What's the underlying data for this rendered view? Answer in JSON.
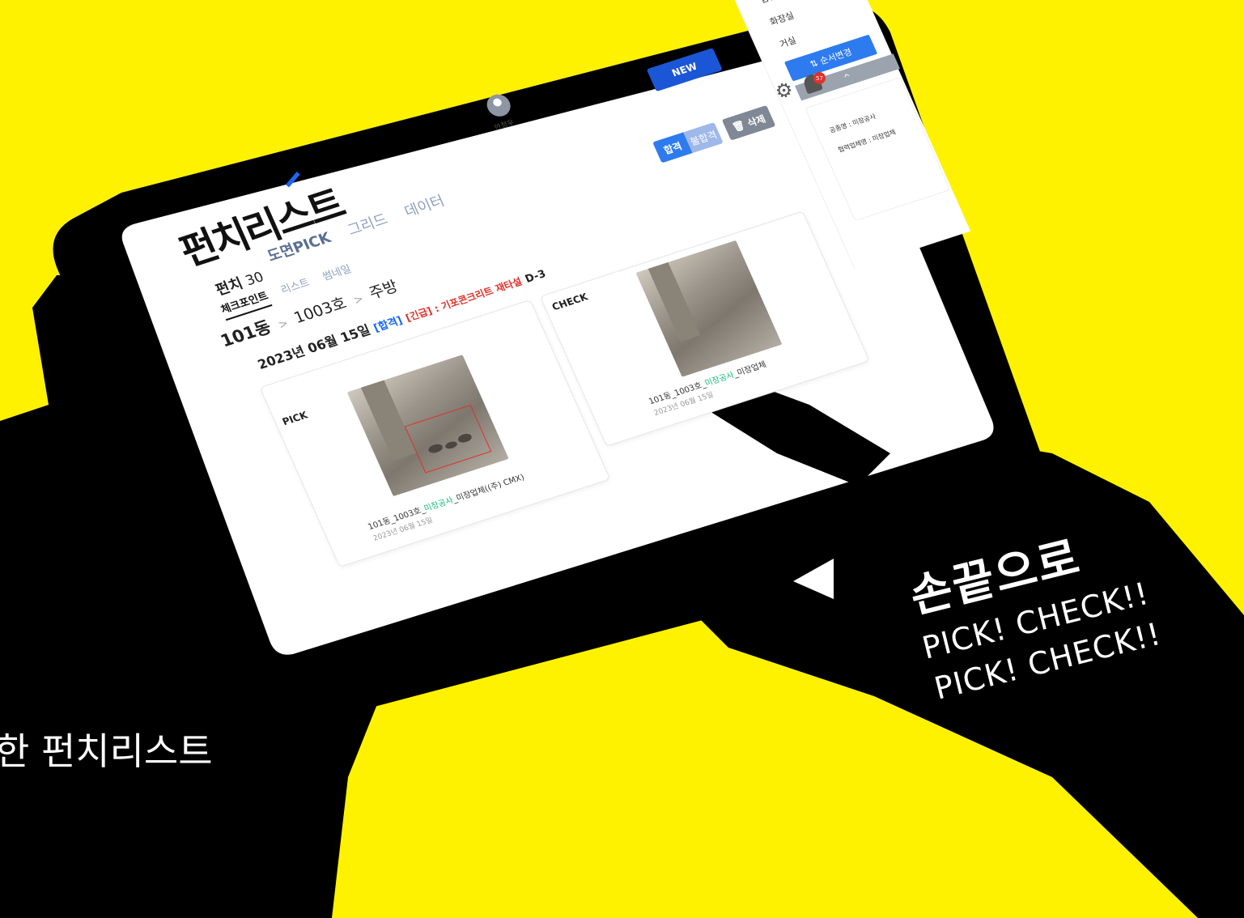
{
  "app": {
    "logo": "펀치리스트",
    "nav_tabs": [
      "도면PICK",
      "그리드",
      "데이터"
    ],
    "punch_label": "펀치",
    "punch_count": "30",
    "sub_tabs": [
      "체크포인트",
      "리스트",
      "썸네일"
    ],
    "user_name": "안정우",
    "notification_count": "57"
  },
  "toolbar": {
    "new_label": "NEW",
    "pass_label": "합격",
    "fail_label": "불합격",
    "delete_label": "삭제"
  },
  "breadcrumb": {
    "building": "101동",
    "unit": "1003호",
    "room": "주방"
  },
  "record": {
    "date": "2023년 06월 15일",
    "status": "[합격]",
    "urgent": "[긴급] : 기포콘크리트 재타설",
    "dday": "D-3"
  },
  "pick_card": {
    "label": "PICK",
    "caption_prefix": "101동_1003호_",
    "caption_trade": "미장공사",
    "caption_suffix": "_미장업체((주) CMX)",
    "caption_date": "2023년 06월 15일"
  },
  "check_card": {
    "label": "CHECK",
    "caption_prefix": "101동_1003호_",
    "caption_trade": "미장공사",
    "caption_suffix": "_미장업체",
    "caption_date": "2023년 06월 15일"
  },
  "side_panel": {
    "rooms": [
      "침실",
      "화장실",
      "거실"
    ],
    "order_button": "⇅ 순서변경",
    "collapse_button": "^",
    "trade_name": "공종명 : 미장공사",
    "partner_name": "협력업체명 : 미장업체"
  },
  "hand_text": {
    "line1": "손끝으로",
    "line2": "PICK! CHECK!!",
    "line3": "PICK! CHECK!!"
  },
  "tagline": "한 펀치리스트",
  "colors": {
    "background": "#fff200",
    "primary": "#1a56d6",
    "urgent": "#e0312b",
    "trade": "#14b87a"
  }
}
